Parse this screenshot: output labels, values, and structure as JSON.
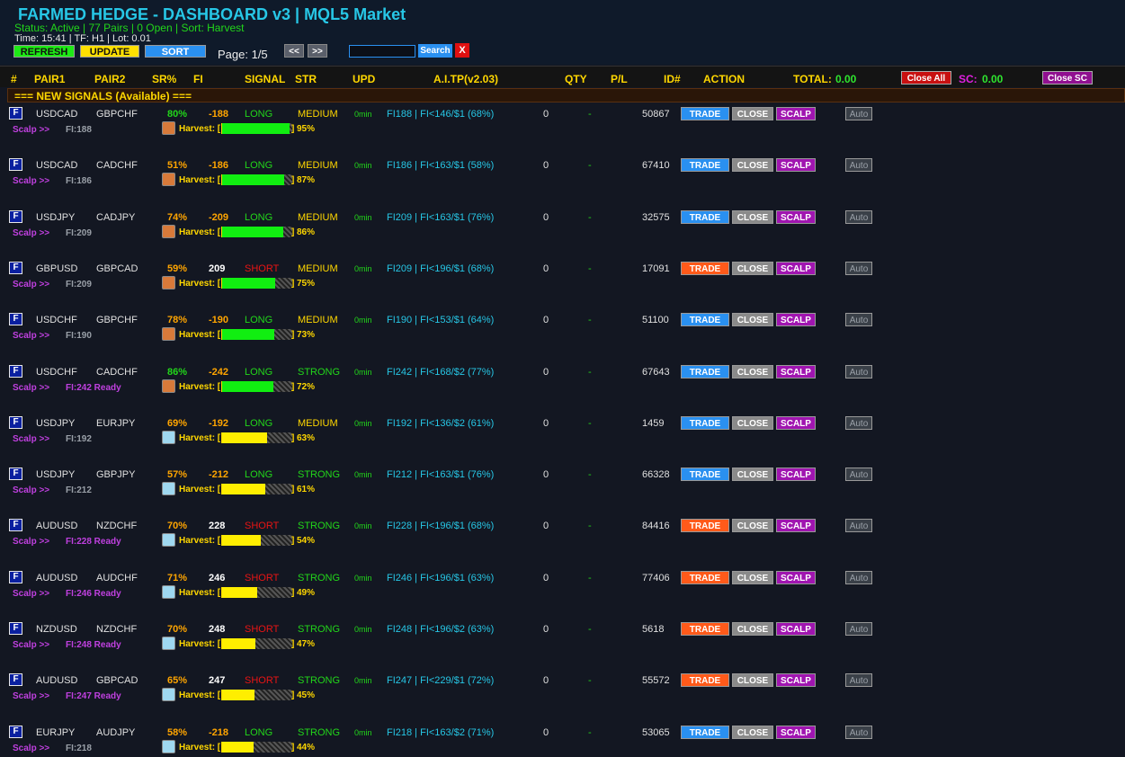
{
  "header": {
    "title": "FARMED HEDGE - DASHBOARD v3 | MQL5 Market",
    "status": "Status: Active | 77 Pairs | 0 Open | Sort: Harvest",
    "time": "Time: 15:41 | TF: H1 | Lot: 0.01",
    "buttons": {
      "refresh": "REFRESH",
      "update": "UPDATE",
      "sort": "SORT"
    },
    "page": "Page: 1/5",
    "prev": "<<",
    "next": ">>",
    "search_value": "",
    "search_button": "Search",
    "clear_button": "X"
  },
  "columns": {
    "num": "#",
    "pair1": "PAIR1",
    "pair2": "PAIR2",
    "sr": "SR%",
    "fi": "FI",
    "signal": "SIGNAL",
    "str": "STR",
    "upd": "UPD",
    "tp": "A.I.TP(v2.03)",
    "qty": "QTY",
    "pl": "P/L",
    "id": "ID#",
    "action": "ACTION",
    "total_label": "TOTAL:",
    "total_value": "0.00",
    "close_all": "Close All",
    "sc_label": "SC:",
    "sc_value": "0.00",
    "close_sc": "Close SC"
  },
  "section_title": "=== NEW SIGNALS (Available) ===",
  "row_labels": {
    "badge": "F",
    "scalp": "Scalp >>",
    "harvest": "Harvest: [",
    "bar_end": "]",
    "trade": "TRADE",
    "close": "CLOSE",
    "scalp_btn": "SCALP",
    "auto": "Auto"
  },
  "colors": {
    "long": "#22d61a",
    "short": "#e81414",
    "medium": "#ffd700",
    "strong": "#22d61a",
    "trade_long": "#2a90f0",
    "trade_short": "#ff5a1a",
    "harvest_high": "#11ee11",
    "harvest_mid": "#ffee00",
    "fi_ready": "#c040e0",
    "fi_normal": "#9aa0a8",
    "sr_high": "#22d61a",
    "sr_mid": "#ffa500",
    "icon_mushroom": "#d87a3a",
    "icon_cloud": "#9fd8f0"
  },
  "signals": [
    {
      "pair1": "USDCAD",
      "pair2": "GBPCHF",
      "sr": "80%",
      "fi": "-188",
      "signal": "LONG",
      "strength": "MEDIUM",
      "upd": "0min",
      "tp": "FI188 | FI<146/$1 (68%)",
      "qty": "0",
      "pl": "-",
      "id": "50867",
      "fi_label": "FI:188",
      "harvest": 0.95,
      "harvest_text": "95%"
    },
    {
      "pair1": "USDCAD",
      "pair2": "CADCHF",
      "sr": "51%",
      "fi": "-186",
      "signal": "LONG",
      "strength": "MEDIUM",
      "upd": "0min",
      "tp": "FI186 | FI<163/$1 (58%)",
      "qty": "0",
      "pl": "-",
      "id": "67410",
      "fi_label": "FI:186",
      "harvest": 0.87,
      "harvest_text": "87%"
    },
    {
      "pair1": "USDJPY",
      "pair2": "CADJPY",
      "sr": "74%",
      "fi": "-209",
      "signal": "LONG",
      "strength": "MEDIUM",
      "upd": "0min",
      "tp": "FI209 | FI<163/$1 (76%)",
      "qty": "0",
      "pl": "-",
      "id": "32575",
      "fi_label": "FI:209",
      "harvest": 0.86,
      "harvest_text": "86%"
    },
    {
      "pair1": "GBPUSD",
      "pair2": "GBPCAD",
      "sr": "59%",
      "fi": "209",
      "signal": "SHORT",
      "strength": "MEDIUM",
      "upd": "0min",
      "tp": "FI209 | FI<196/$1 (68%)",
      "qty": "0",
      "pl": "-",
      "id": "17091",
      "fi_label": "FI:209",
      "harvest": 0.75,
      "harvest_text": "75%"
    },
    {
      "pair1": "USDCHF",
      "pair2": "GBPCHF",
      "sr": "78%",
      "fi": "-190",
      "signal": "LONG",
      "strength": "MEDIUM",
      "upd": "0min",
      "tp": "FI190 | FI<153/$1 (64%)",
      "qty": "0",
      "pl": "-",
      "id": "51100",
      "fi_label": "FI:190",
      "harvest": 0.73,
      "harvest_text": "73%"
    },
    {
      "pair1": "USDCHF",
      "pair2": "CADCHF",
      "sr": "86%",
      "fi": "-242",
      "signal": "LONG",
      "strength": "STRONG",
      "upd": "0min",
      "tp": "FI242 | FI<168/$2 (77%)",
      "qty": "0",
      "pl": "-",
      "id": "67643",
      "fi_label": "FI:242 Ready",
      "harvest": 0.72,
      "harvest_text": "72%"
    },
    {
      "pair1": "USDJPY",
      "pair2": "EURJPY",
      "sr": "69%",
      "fi": "-192",
      "signal": "LONG",
      "strength": "MEDIUM",
      "upd": "0min",
      "tp": "FI192 | FI<136/$2 (61%)",
      "qty": "0",
      "pl": "-",
      "id": "1459",
      "fi_label": "FI:192",
      "harvest": 0.63,
      "harvest_text": "63%"
    },
    {
      "pair1": "USDJPY",
      "pair2": "GBPJPY",
      "sr": "57%",
      "fi": "-212",
      "signal": "LONG",
      "strength": "STRONG",
      "upd": "0min",
      "tp": "FI212 | FI<163/$1 (76%)",
      "qty": "0",
      "pl": "-",
      "id": "66328",
      "fi_label": "FI:212",
      "harvest": 0.61,
      "harvest_text": "61%"
    },
    {
      "pair1": "AUDUSD",
      "pair2": "NZDCHF",
      "sr": "70%",
      "fi": "228",
      "signal": "SHORT",
      "strength": "STRONG",
      "upd": "0min",
      "tp": "FI228 | FI<196/$1 (68%)",
      "qty": "0",
      "pl": "-",
      "id": "84416",
      "fi_label": "FI:228 Ready",
      "harvest": 0.54,
      "harvest_text": "54%"
    },
    {
      "pair1": "AUDUSD",
      "pair2": "AUDCHF",
      "sr": "71%",
      "fi": "246",
      "signal": "SHORT",
      "strength": "STRONG",
      "upd": "0min",
      "tp": "FI246 | FI<196/$1 (63%)",
      "qty": "0",
      "pl": "-",
      "id": "77406",
      "fi_label": "FI:246 Ready",
      "harvest": 0.49,
      "harvest_text": "49%"
    },
    {
      "pair1": "NZDUSD",
      "pair2": "NZDCHF",
      "sr": "70%",
      "fi": "248",
      "signal": "SHORT",
      "strength": "STRONG",
      "upd": "0min",
      "tp": "FI248 | FI<196/$2 (63%)",
      "qty": "0",
      "pl": "-",
      "id": "5618",
      "fi_label": "FI:248 Ready",
      "harvest": 0.47,
      "harvest_text": "47%"
    },
    {
      "pair1": "AUDUSD",
      "pair2": "GBPCAD",
      "sr": "65%",
      "fi": "247",
      "signal": "SHORT",
      "strength": "STRONG",
      "upd": "0min",
      "tp": "FI247 | FI<229/$1 (72%)",
      "qty": "0",
      "pl": "-",
      "id": "55572",
      "fi_label": "FI:247 Ready",
      "harvest": 0.45,
      "harvest_text": "45%"
    },
    {
      "pair1": "EURJPY",
      "pair2": "AUDJPY",
      "sr": "58%",
      "fi": "-218",
      "signal": "LONG",
      "strength": "STRONG",
      "upd": "0min",
      "tp": "FI218 | FI<163/$2 (71%)",
      "qty": "0",
      "pl": "-",
      "id": "53065",
      "fi_label": "FI:218",
      "harvest": 0.44,
      "harvest_text": "44%"
    }
  ]
}
